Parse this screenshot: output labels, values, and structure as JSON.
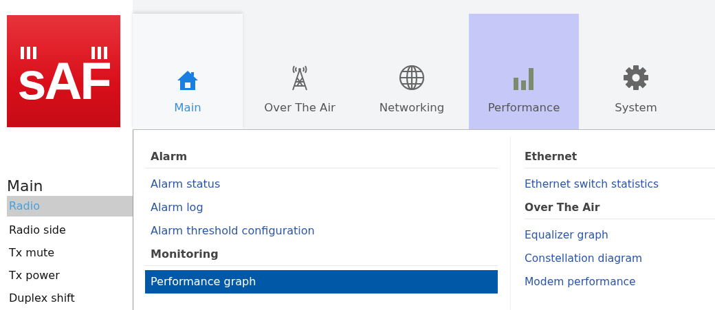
{
  "logo": {
    "text": "sAF"
  },
  "tabs": [
    {
      "label": "Main",
      "kind": "house",
      "selected": true,
      "highlighted": false
    },
    {
      "label": "Over The Air",
      "kind": "tower",
      "selected": false,
      "highlighted": false
    },
    {
      "label": "Networking",
      "kind": "globe",
      "selected": false,
      "highlighted": false
    },
    {
      "label": "Performance",
      "kind": "bars",
      "selected": false,
      "highlighted": true
    },
    {
      "label": "System",
      "kind": "gear",
      "selected": false,
      "highlighted": false
    }
  ],
  "sidebar": {
    "title": "Main",
    "items": [
      {
        "label": "Radio",
        "selected": true
      },
      {
        "label": "Radio side",
        "selected": false
      },
      {
        "label": "Tx mute",
        "selected": false
      },
      {
        "label": "Tx power",
        "selected": false
      },
      {
        "label": "Duplex shift",
        "selected": false
      }
    ]
  },
  "menu": {
    "columns": [
      {
        "sections": [
          {
            "heading": "Alarm",
            "items": [
              {
                "label": "Alarm status",
                "selected": false
              },
              {
                "label": "Alarm log",
                "selected": false
              },
              {
                "label": "Alarm threshold configuration",
                "selected": false
              }
            ]
          },
          {
            "heading": "Monitoring",
            "items": [
              {
                "label": "Performance graph",
                "selected": true
              }
            ]
          }
        ]
      },
      {
        "sections": [
          {
            "heading": "Ethernet",
            "items": [
              {
                "label": "Ethernet switch statistics",
                "selected": false
              }
            ]
          },
          {
            "heading": "Over The Air",
            "items": [
              {
                "label": "Equalizer graph",
                "selected": false
              },
              {
                "label": "Constellation diagram",
                "selected": false
              },
              {
                "label": "Modem performance",
                "selected": false
              }
            ]
          }
        ]
      }
    ]
  }
}
